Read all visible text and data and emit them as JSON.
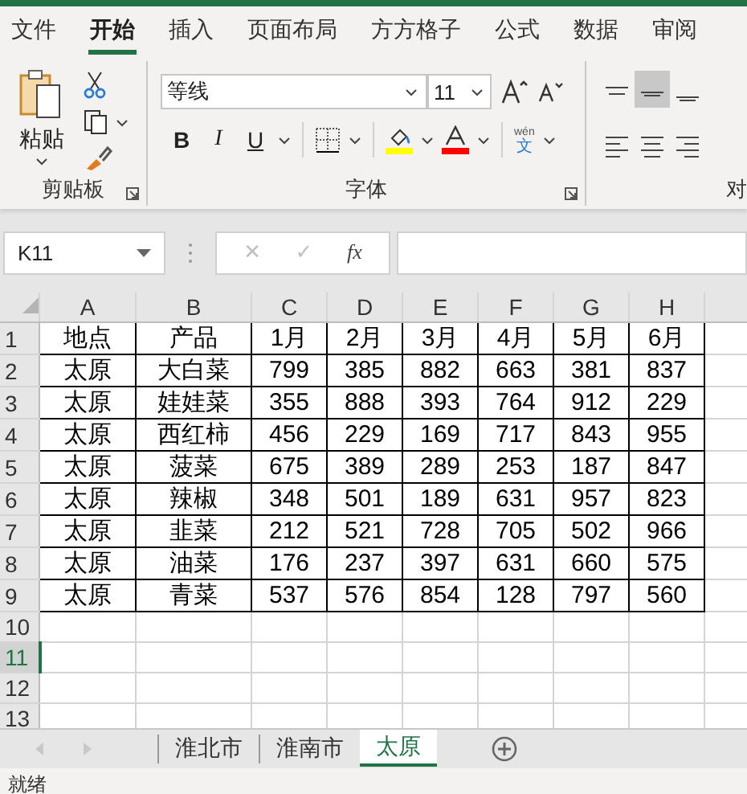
{
  "ribbon_tabs": [
    {
      "label": "文件",
      "selected": false
    },
    {
      "label": "开始",
      "selected": true
    },
    {
      "label": "插入",
      "selected": false
    },
    {
      "label": "页面布局",
      "selected": false
    },
    {
      "label": "方方格子",
      "selected": false
    },
    {
      "label": "公式",
      "selected": false
    },
    {
      "label": "数据",
      "selected": false
    },
    {
      "label": "审阅",
      "selected": false
    }
  ],
  "clipboard": {
    "paste": "粘贴",
    "group_label": "剪贴板"
  },
  "font": {
    "font_name": "等线",
    "font_size": "11",
    "bold": "B",
    "italic": "I",
    "underline": "U",
    "phonetic_top": "wén",
    "phonetic_bottom": "文",
    "group_label": "字体"
  },
  "alignment": {
    "group_label": "对",
    "buttons": [
      {
        "kind": "top",
        "selected": false
      },
      {
        "kind": "middle",
        "selected": true
      },
      {
        "kind": "bottom",
        "selected": false
      },
      {
        "kind": "left",
        "selected": false
      },
      {
        "kind": "center",
        "selected": false
      },
      {
        "kind": "right",
        "selected": false
      }
    ]
  },
  "formula_bar": {
    "name_box": "K11",
    "cancel": "✕",
    "enter": "✓",
    "fx": "fx"
  },
  "columns": [
    "A",
    "B",
    "C",
    "D",
    "E",
    "F",
    "G",
    "H"
  ],
  "rows": [
    {
      "header": "1",
      "selected": false,
      "cells": [
        "地点",
        "产品",
        "1月",
        "2月",
        "3月",
        "4月",
        "5月",
        "6月"
      ]
    },
    {
      "header": "2",
      "selected": false,
      "cells": [
        "太原",
        "大白菜",
        "799",
        "385",
        "882",
        "663",
        "381",
        "837"
      ]
    },
    {
      "header": "3",
      "selected": false,
      "cells": [
        "太原",
        "娃娃菜",
        "355",
        "888",
        "393",
        "764",
        "912",
        "229"
      ]
    },
    {
      "header": "4",
      "selected": false,
      "cells": [
        "太原",
        "西红柿",
        "456",
        "229",
        "169",
        "717",
        "843",
        "955"
      ]
    },
    {
      "header": "5",
      "selected": false,
      "cells": [
        "太原",
        "菠菜",
        "675",
        "389",
        "289",
        "253",
        "187",
        "847"
      ]
    },
    {
      "header": "6",
      "selected": false,
      "cells": [
        "太原",
        "辣椒",
        "348",
        "501",
        "189",
        "631",
        "957",
        "823"
      ]
    },
    {
      "header": "7",
      "selected": false,
      "cells": [
        "太原",
        "韭菜",
        "212",
        "521",
        "728",
        "705",
        "502",
        "966"
      ]
    },
    {
      "header": "8",
      "selected": false,
      "cells": [
        "太原",
        "油菜",
        "176",
        "237",
        "397",
        "631",
        "660",
        "575"
      ]
    },
    {
      "header": "9",
      "selected": false,
      "cells": [
        "太原",
        "青菜",
        "537",
        "576",
        "854",
        "128",
        "797",
        "560"
      ]
    },
    {
      "header": "10",
      "selected": false
    },
    {
      "header": "11",
      "selected": true
    },
    {
      "header": "12",
      "selected": false
    },
    {
      "header": "13",
      "selected": false
    }
  ],
  "sheet_tabs": [
    {
      "label": "淮北市",
      "selected": false
    },
    {
      "label": "淮南市",
      "selected": false
    },
    {
      "label": "太原",
      "selected": true
    }
  ],
  "status_bar": "就绪"
}
